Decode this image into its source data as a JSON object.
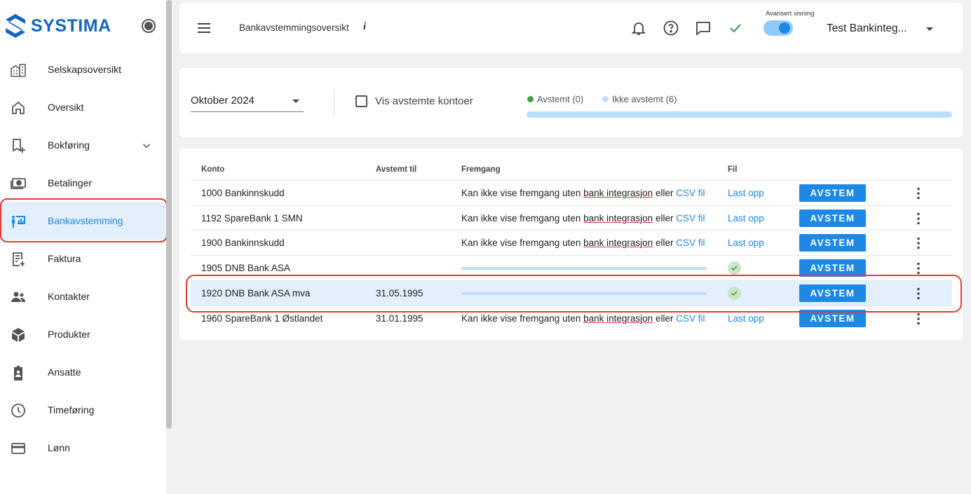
{
  "app": {
    "logo_text": "SYSTIMA"
  },
  "sidebar": {
    "items": [
      {
        "label": "Selskapsoversikt",
        "icon": "building-icon"
      },
      {
        "label": "Oversikt",
        "icon": "home-icon"
      },
      {
        "label": "Bokføring",
        "icon": "bookmark-add-icon",
        "expandable": true
      },
      {
        "label": "Betalinger",
        "icon": "payments-icon"
      },
      {
        "label": "Bankavstemming",
        "icon": "bank-reconcile-icon",
        "active": true
      },
      {
        "label": "Faktura",
        "icon": "invoice-icon"
      },
      {
        "label": "Kontakter",
        "icon": "people-icon"
      },
      {
        "label": "Produkter",
        "icon": "box-icon"
      },
      {
        "label": "Ansatte",
        "icon": "badge-icon"
      },
      {
        "label": "Timeføring",
        "icon": "clock-icon"
      },
      {
        "label": "Lønn",
        "icon": "card-icon"
      }
    ]
  },
  "header": {
    "title": "Bankavstemmingsoversikt",
    "info_glyph": "i",
    "advanced_label": "Avansert visning",
    "advanced_on": true,
    "company": "Test Bankinteg..."
  },
  "filter": {
    "month": "Oktober 2024",
    "show_reconciled_label": "Vis avstemte kontoer",
    "show_reconciled_checked": false,
    "legend_reconciled": "Avstemt (0)",
    "legend_not_reconciled": "Ikke avstemt (6)",
    "reconciled_fraction": 0,
    "colors": {
      "reconciled": "#43a047",
      "not_reconciled": "#bbdefb",
      "accent": "#1e88e5"
    }
  },
  "table": {
    "columns": {
      "konto": "Konto",
      "avstemt_til": "Avstemt til",
      "fremgang": "Fremgang",
      "fil": "Fil"
    },
    "no_progress_prefix": "Kan ikke vise fremgang uten ",
    "no_progress_link": "bank integrasjon",
    "no_progress_mid": " eller ",
    "csv_link": "CSV fil",
    "upload_label": "Last opp",
    "button_label": "AVSTEM",
    "rows": [
      {
        "konto": "1000 Bankinnskudd",
        "avstemt_til": "",
        "integrated": false
      },
      {
        "konto": "1192 SpareBank 1 SMN",
        "avstemt_til": "",
        "integrated": false
      },
      {
        "konto": "1900 Bankinnskudd",
        "avstemt_til": "",
        "integrated": false
      },
      {
        "konto": "1905 DNB Bank ASA",
        "avstemt_til": "",
        "integrated": true
      },
      {
        "konto": "1920 DNB Bank ASA mva",
        "avstemt_til": "31.05.1995",
        "integrated": true,
        "selected": true
      },
      {
        "konto": "1960 SpareBank 1 Østlandet",
        "avstemt_til": "31.01.1995",
        "integrated": false
      }
    ]
  }
}
